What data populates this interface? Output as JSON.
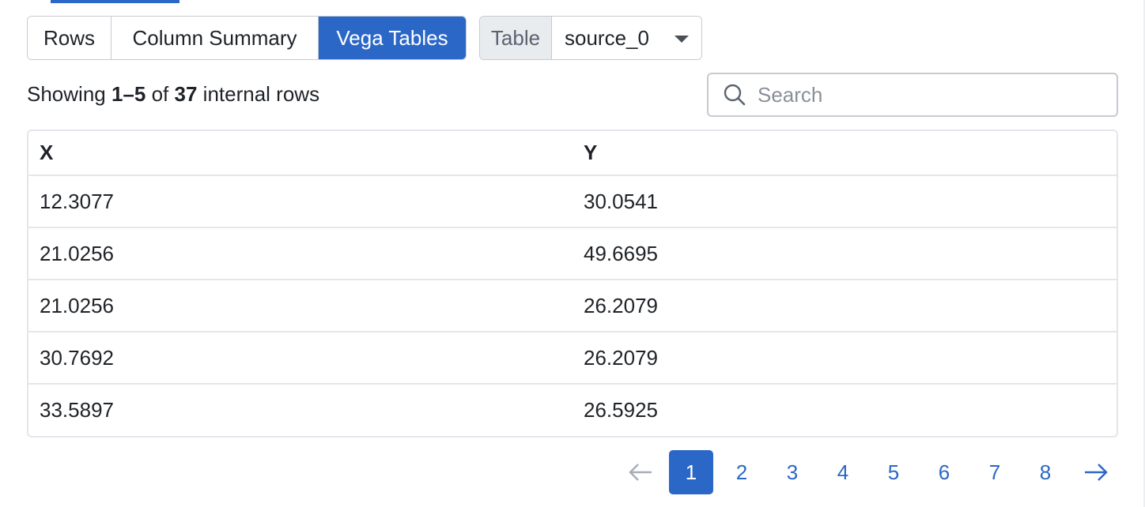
{
  "tabs": {
    "rows": "Rows",
    "column_summary": "Column Summary",
    "vega_tables": "Vega Tables"
  },
  "table_select": {
    "label": "Table",
    "value": "source_0"
  },
  "status": {
    "prefix": "Showing",
    "range": "1–5",
    "of": "of",
    "total": "37",
    "suffix": "internal rows"
  },
  "search": {
    "placeholder": "Search",
    "value": ""
  },
  "table": {
    "headers": [
      "X",
      "Y"
    ],
    "rows": [
      [
        "12.3077",
        "30.0541"
      ],
      [
        "21.0256",
        "49.6695"
      ],
      [
        "21.0256",
        "26.2079"
      ],
      [
        "30.7692",
        "26.2079"
      ],
      [
        "33.5897",
        "26.5925"
      ]
    ]
  },
  "pagination": {
    "pages": [
      "1",
      "2",
      "3",
      "4",
      "5",
      "6",
      "7",
      "8"
    ],
    "current": "1",
    "prev_icon": "arrow-left-icon",
    "next_icon": "arrow-right-icon"
  },
  "colors": {
    "accent": "#2b67c6",
    "border": "#c6cbd2",
    "label_bg": "#e9ecef"
  }
}
